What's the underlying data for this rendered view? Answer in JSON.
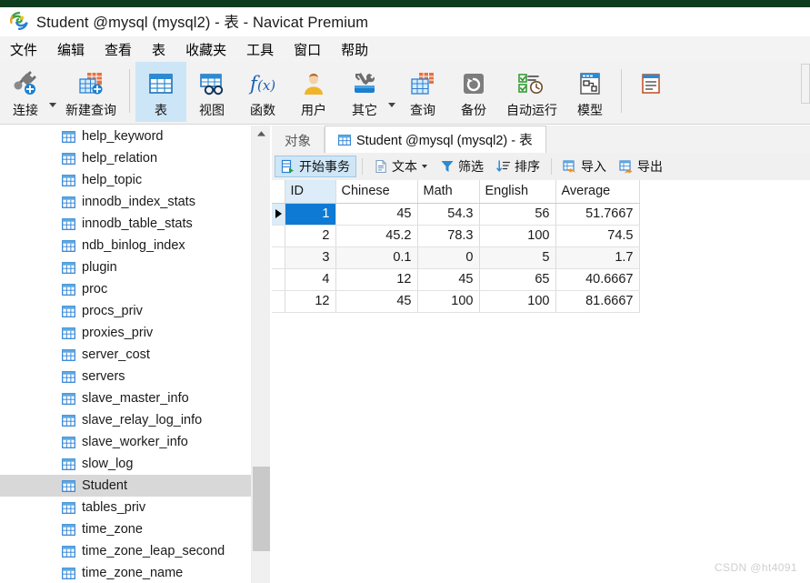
{
  "window": {
    "title": "Student @mysql (mysql2) - 表 - Navicat Premium",
    "logo_icon": "navicat-logo-icon"
  },
  "menubar": {
    "items": [
      {
        "label": "文件",
        "name": "menu-file"
      },
      {
        "label": "编辑",
        "name": "menu-edit"
      },
      {
        "label": "查看",
        "name": "menu-view"
      },
      {
        "label": "表",
        "name": "menu-table"
      },
      {
        "label": "收藏夹",
        "name": "menu-favorites"
      },
      {
        "label": "工具",
        "name": "menu-tools"
      },
      {
        "label": "窗口",
        "name": "menu-window"
      },
      {
        "label": "帮助",
        "name": "menu-help"
      }
    ]
  },
  "ribbon": {
    "buttons": [
      {
        "label": "连接",
        "icon": "connection-plug-icon",
        "active": false,
        "caret": true
      },
      {
        "label": "新建查询",
        "icon": "new-query-icon",
        "active": false,
        "caret": false
      },
      {
        "label": "表",
        "icon": "table-grid-icon",
        "active": true,
        "caret": false
      },
      {
        "label": "视图",
        "icon": "view-glasses-icon",
        "active": false,
        "caret": false
      },
      {
        "label": "函数",
        "icon": "function-fx-icon",
        "active": false,
        "caret": false
      },
      {
        "label": "用户",
        "icon": "user-person-icon",
        "active": false,
        "caret": false
      },
      {
        "label": "其它",
        "icon": "other-tools-icon",
        "active": false,
        "caret": true
      },
      {
        "label": "查询",
        "icon": "query-calendar-icon",
        "active": false,
        "caret": false
      },
      {
        "label": "备份",
        "icon": "backup-restore-icon",
        "active": false,
        "caret": false
      },
      {
        "label": "自动运行",
        "icon": "automation-clock-icon",
        "active": false,
        "caret": false
      },
      {
        "label": "模型",
        "icon": "model-diagram-icon",
        "active": false,
        "caret": false
      }
    ]
  },
  "sidebar": {
    "tables": [
      {
        "label": "help_keyword",
        "selected": false
      },
      {
        "label": "help_relation",
        "selected": false
      },
      {
        "label": "help_topic",
        "selected": false
      },
      {
        "label": "innodb_index_stats",
        "selected": false
      },
      {
        "label": "innodb_table_stats",
        "selected": false
      },
      {
        "label": "ndb_binlog_index",
        "selected": false
      },
      {
        "label": "plugin",
        "selected": false
      },
      {
        "label": "proc",
        "selected": false
      },
      {
        "label": "procs_priv",
        "selected": false
      },
      {
        "label": "proxies_priv",
        "selected": false
      },
      {
        "label": "server_cost",
        "selected": false
      },
      {
        "label": "servers",
        "selected": false
      },
      {
        "label": "slave_master_info",
        "selected": false
      },
      {
        "label": "slave_relay_log_info",
        "selected": false
      },
      {
        "label": "slave_worker_info",
        "selected": false
      },
      {
        "label": "slow_log",
        "selected": false
      },
      {
        "label": "Student",
        "selected": true
      },
      {
        "label": "tables_priv",
        "selected": false
      },
      {
        "label": "time_zone",
        "selected": false
      },
      {
        "label": "time_zone_leap_second",
        "selected": false
      },
      {
        "label": "time_zone_name",
        "selected": false
      }
    ]
  },
  "tabs": [
    {
      "label": "对象",
      "active": false,
      "icon": null
    },
    {
      "label": "Student @mysql (mysql2) - 表",
      "active": true,
      "icon": "table-grid-icon"
    }
  ],
  "grid_toolbar": {
    "buttons": [
      {
        "label": "开始事务",
        "icon": "transaction-icon",
        "active": true,
        "caret": false
      },
      {
        "label": "文本",
        "icon": "text-doc-icon",
        "active": false,
        "caret": true
      },
      {
        "label": "筛选",
        "icon": "filter-funnel-icon",
        "active": false,
        "caret": false
      },
      {
        "label": "排序",
        "icon": "sort-icon",
        "active": false,
        "caret": false
      },
      {
        "label": "导入",
        "icon": "import-icon",
        "active": false,
        "caret": false
      },
      {
        "label": "导出",
        "icon": "export-icon",
        "active": false,
        "caret": false
      }
    ]
  },
  "table_data": {
    "columns": [
      "ID",
      "Chinese",
      "Math",
      "English",
      "Average"
    ],
    "active_column": "ID",
    "selected_row_index": 0,
    "selected_cell": {
      "row": 0,
      "column": "ID"
    },
    "rows": [
      {
        "ID": "1",
        "Chinese": "45",
        "Math": "54.3",
        "English": "56",
        "Average": "51.7667"
      },
      {
        "ID": "2",
        "Chinese": "45.2",
        "Math": "78.3",
        "English": "100",
        "Average": "74.5"
      },
      {
        "ID": "3",
        "Chinese": "0.1",
        "Math": "0",
        "English": "5",
        "Average": "1.7"
      },
      {
        "ID": "4",
        "Chinese": "12",
        "Math": "45",
        "English": "65",
        "Average": "40.6667"
      },
      {
        "ID": "12",
        "Chinese": "45",
        "Math": "100",
        "English": "100",
        "Average": "81.6667"
      }
    ]
  },
  "watermark": {
    "text": "CSDN @ht4091"
  },
  "colors": {
    "accent_blue": "#0f7ad4",
    "active_tab_blue": "#cde6f7",
    "header_col_active": "#dcecf8",
    "selection_gray": "#d8d8d8",
    "top_strip_green": "#0c3b1e"
  }
}
